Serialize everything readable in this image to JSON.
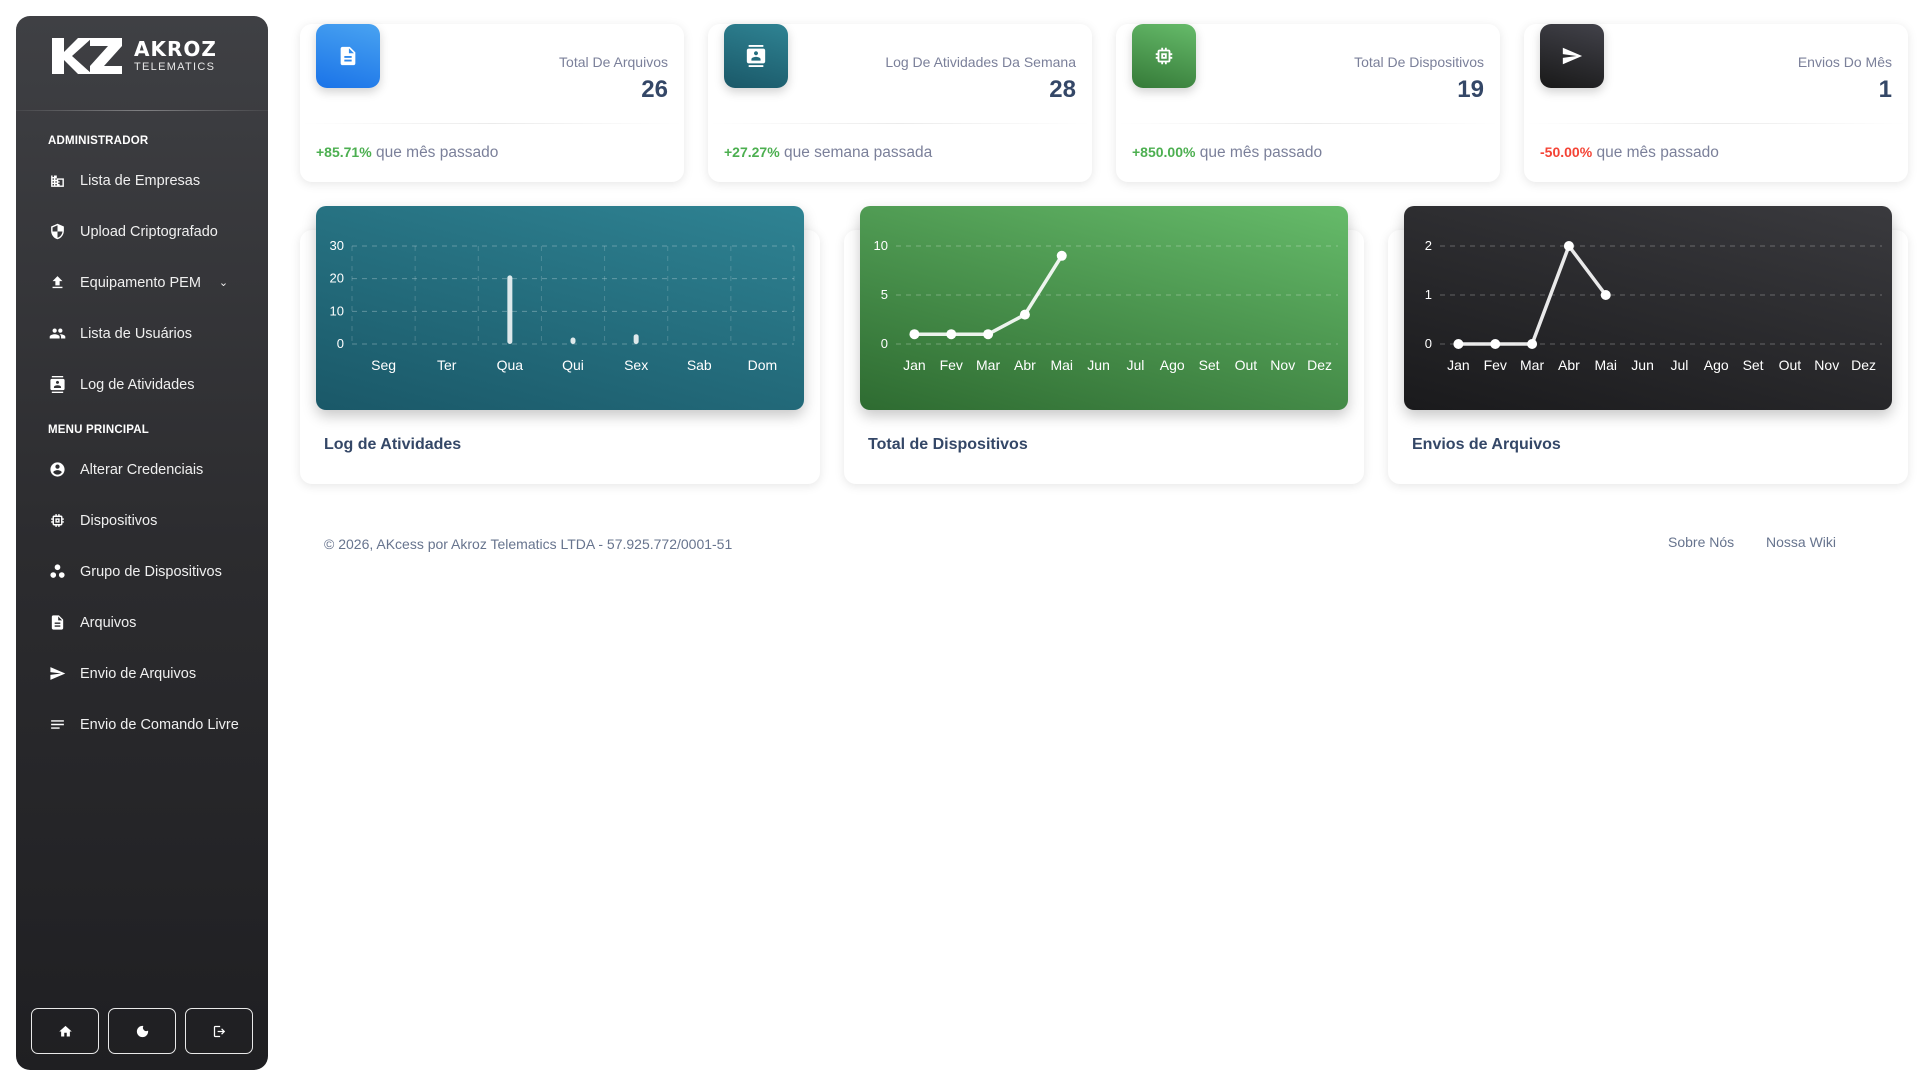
{
  "brand": {
    "name": "AKROZ",
    "subtitle": "TELEMATICS",
    "mark": "KZ"
  },
  "sidebar": {
    "section_admin": "ADMINISTRADOR",
    "section_main": "MENU PRINCIPAL",
    "admin_items": [
      {
        "label": "Lista de Empresas",
        "icon": "building-icon"
      },
      {
        "label": "Upload Criptografado",
        "icon": "shield-icon"
      },
      {
        "label": "Equipamento PEM",
        "icon": "upload-icon"
      },
      {
        "label": "Lista de Usuários",
        "icon": "users-icon"
      },
      {
        "label": "Log de Atividades",
        "icon": "contact-card-icon"
      }
    ],
    "main_items": [
      {
        "label": "Alterar Credenciais",
        "icon": "account-circle-icon"
      },
      {
        "label": "Dispositivos",
        "icon": "chip-icon"
      },
      {
        "label": "Grupo de Dispositivos",
        "icon": "group-icon"
      },
      {
        "label": "Arquivos",
        "icon": "file-icon"
      },
      {
        "label": "Envio de Arquivos",
        "icon": "send-icon"
      },
      {
        "label": "Envio de Comando Livre",
        "icon": "text-lines-icon"
      }
    ],
    "bottom_buttons": [
      "home-icon",
      "moon-icon",
      "logout-icon"
    ]
  },
  "stats": [
    {
      "label": "Total De Arquivos",
      "value": "26",
      "change": "+85.71%",
      "suffix": "que mês passado",
      "color": "#3b8ef0"
    },
    {
      "label": "Log De Atividades Da Semana",
      "value": "28",
      "change": "+27.27%",
      "suffix": "que semana passada",
      "color": "#1f6e7f"
    },
    {
      "label": "Total De Dispositivos",
      "value": "19",
      "change": "+850.00%",
      "suffix": "que mês passado",
      "color": "#4c9a48"
    },
    {
      "label": "Envios Do Mês",
      "value": "1",
      "change": "-50.00%",
      "suffix": "que mês passado",
      "color": "#2b2b2e"
    }
  ],
  "charts": {
    "activity_title": "Log de Atividades",
    "devices_title": "Total de Dispositivos",
    "uploads_title": "Envios de Arquivos"
  },
  "chart_data": [
    {
      "type": "bar",
      "title": "Log de Atividades",
      "categories": [
        "Seg",
        "Ter",
        "Qua",
        "Qui",
        "Sex",
        "Sab",
        "Dom"
      ],
      "values": [
        0,
        0,
        21,
        2,
        3,
        0,
        0
      ],
      "yticks": [
        0,
        10,
        20,
        30
      ],
      "ylim": [
        0,
        30
      ],
      "grid": true
    },
    {
      "type": "line",
      "title": "Total de Dispositivos",
      "categories": [
        "Jan",
        "Fev",
        "Mar",
        "Abr",
        "Mai",
        "Jun",
        "Jul",
        "Ago",
        "Set",
        "Out",
        "Nov",
        "Dez"
      ],
      "values": [
        1,
        1,
        1,
        3,
        9
      ],
      "yticks": [
        0,
        5,
        10
      ],
      "ylim": [
        0,
        10
      ],
      "grid": true
    },
    {
      "type": "line",
      "title": "Envios de Arquivos",
      "categories": [
        "Jan",
        "Fev",
        "Mar",
        "Abr",
        "Mai",
        "Jun",
        "Jul",
        "Ago",
        "Set",
        "Out",
        "Nov",
        "Dez"
      ],
      "values": [
        0,
        0,
        0,
        2,
        1
      ],
      "yticks": [
        0,
        1,
        2
      ],
      "ylim": [
        0,
        2
      ],
      "grid": true
    }
  ],
  "footer": {
    "copyright": "© 2026, AKcess por Akroz Telematics LTDA - 57.925.772/0001-51",
    "link_about": "Sobre Nós",
    "link_wiki": "Nossa Wiki"
  }
}
